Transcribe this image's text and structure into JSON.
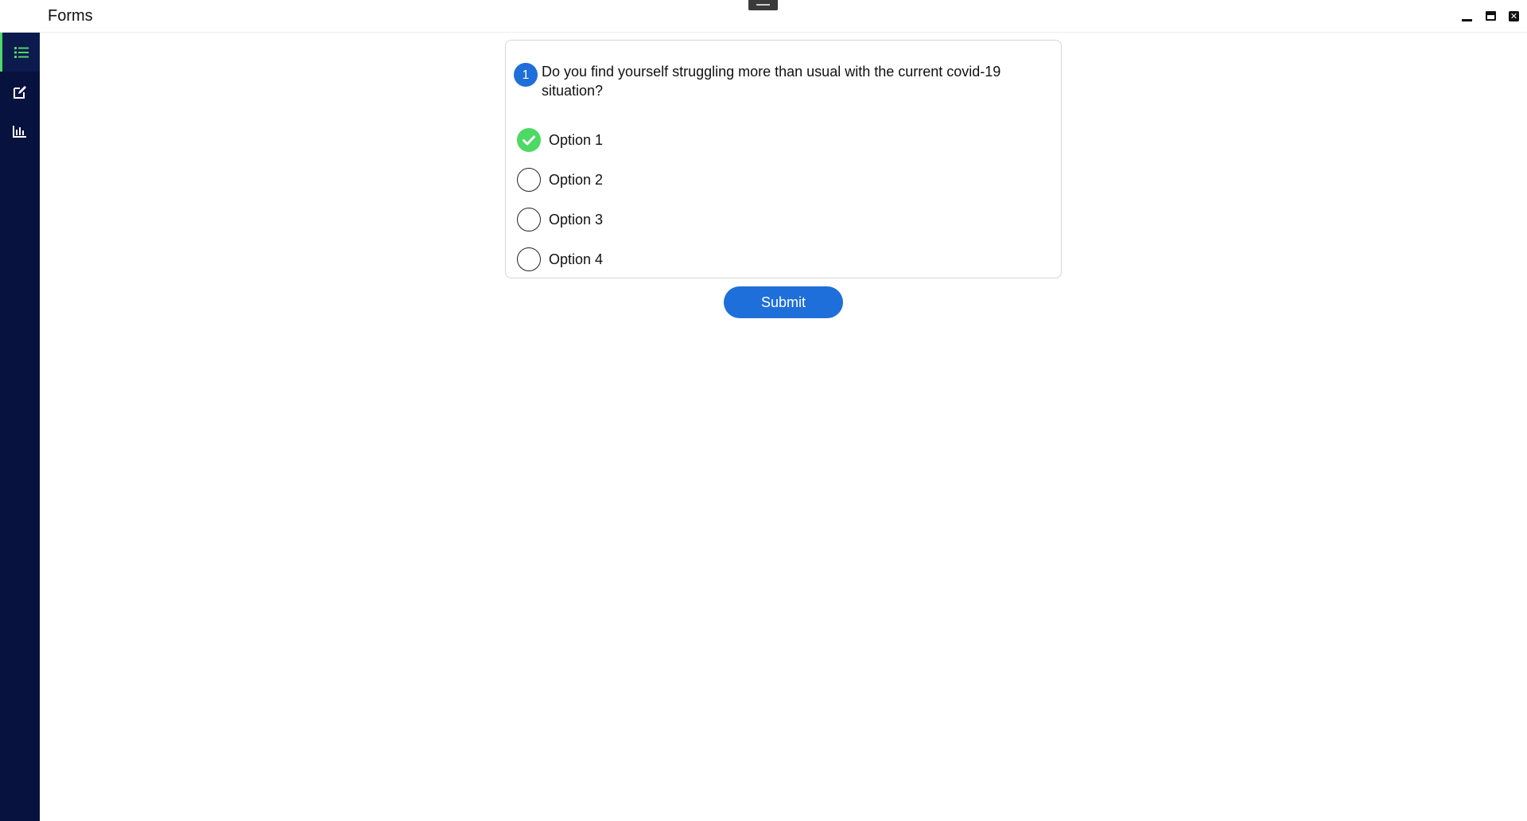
{
  "window": {
    "title": "Forms",
    "controls": [
      "minimize-icon",
      "maximize-icon",
      "close-icon"
    ]
  },
  "sidebar": {
    "items": [
      {
        "icon": "list-icon",
        "active": true
      },
      {
        "icon": "edit-icon",
        "active": false
      },
      {
        "icon": "bar-chart-icon",
        "active": false
      }
    ],
    "accent": "#4cd964",
    "background": "#07123f"
  },
  "question": {
    "number": "1",
    "text": "Do you find yourself struggling more than usual with the current covid-19 situation?",
    "options": [
      {
        "label": "Option 1",
        "selected": true
      },
      {
        "label": "Option 2",
        "selected": false
      },
      {
        "label": "Option 3",
        "selected": false
      },
      {
        "label": "Option 4",
        "selected": false
      }
    ]
  },
  "actions": {
    "submit_label": "Submit"
  },
  "colors": {
    "primary": "#1e6fd9",
    "selected": "#4cd964"
  }
}
